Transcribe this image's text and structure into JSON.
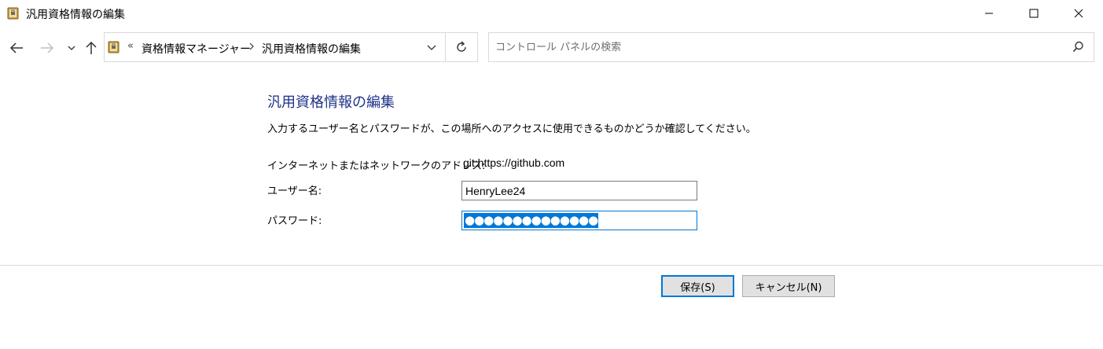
{
  "window": {
    "title": "汎用資格情報の編集"
  },
  "nav": {
    "back_icon": "back-arrow-icon",
    "forward_icon": "forward-arrow-icon",
    "recent_icon": "chevron-down-icon",
    "up_icon": "up-arrow-icon"
  },
  "address": {
    "overflow": "«",
    "crumbs": [
      "資格情報マネージャー",
      "汎用資格情報の編集"
    ]
  },
  "search": {
    "placeholder": "コントロール パネルの検索"
  },
  "main": {
    "title": "汎用資格情報の編集",
    "instructions": "入力するユーザー名とパスワードが、この場所へのアクセスに使用できるものかどうか確認してください。",
    "address_label": "インターネットまたはネットワークのアドレス:",
    "address_value": "git:https://github.com",
    "username_label": "ユーザー名:",
    "username_value": "HenryLee24",
    "password_label": "パスワード:",
    "password_mask": "●●●●●●●●●●●●●●"
  },
  "buttons": {
    "save": "保存(S)",
    "cancel": "キャンセル(N)"
  },
  "colors": {
    "accent": "#0078d7",
    "title": "#1e3287"
  }
}
